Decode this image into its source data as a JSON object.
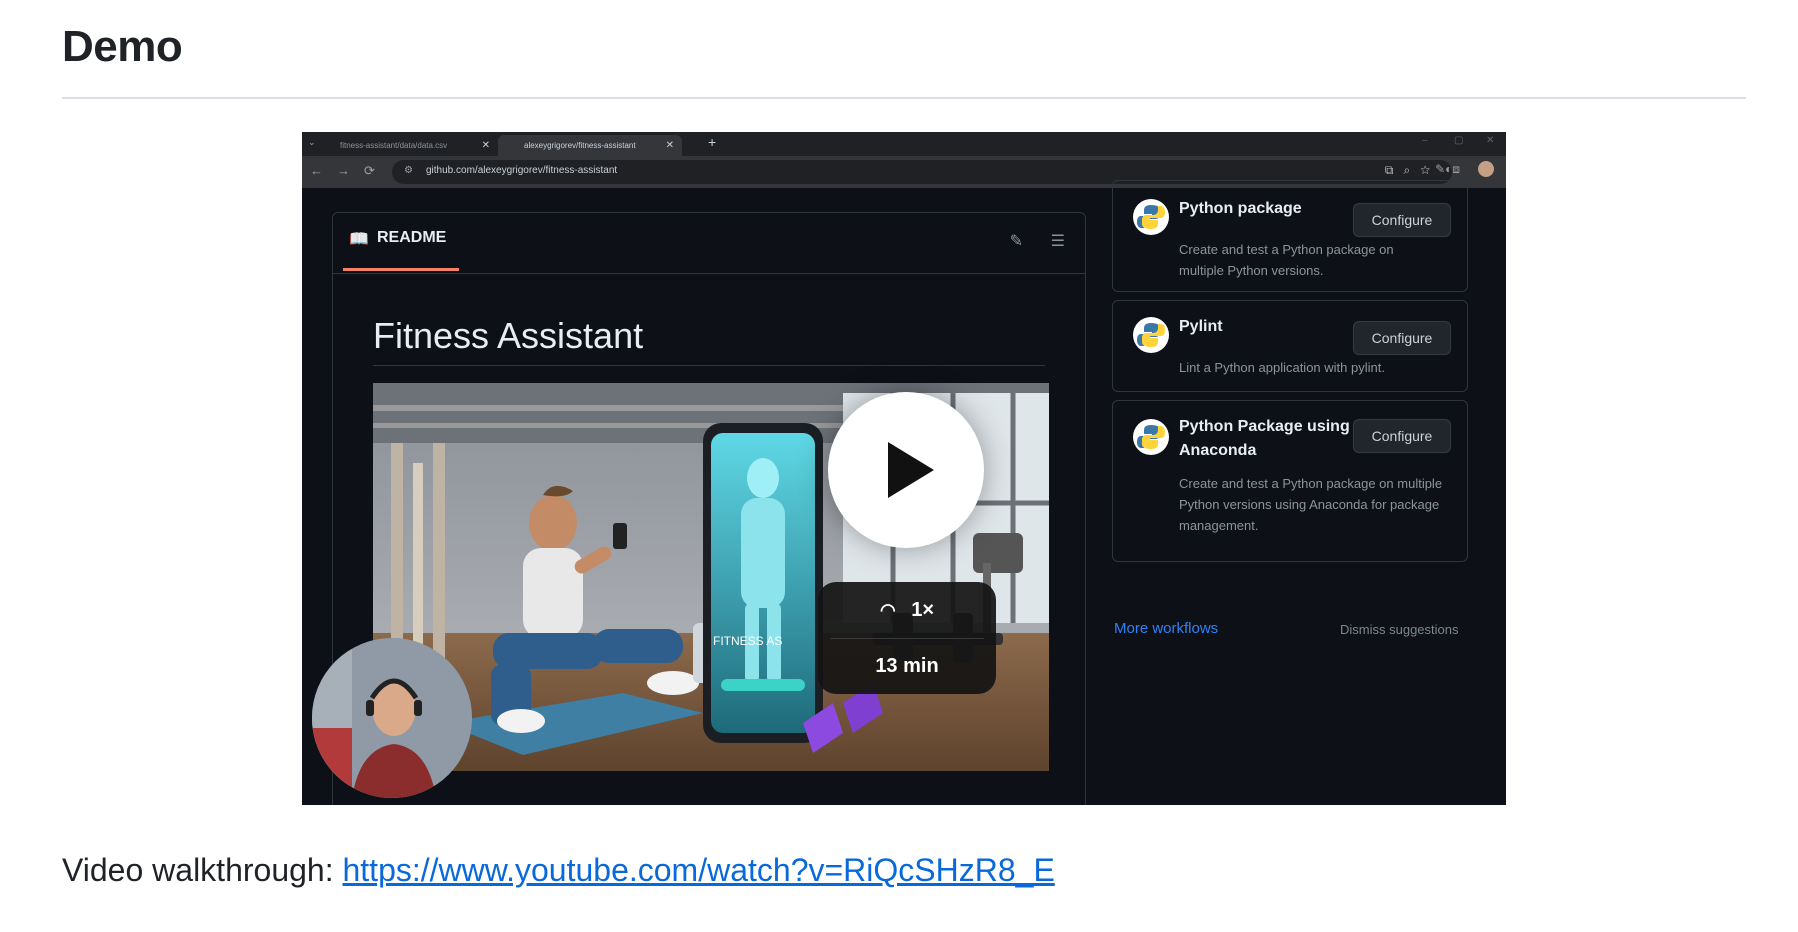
{
  "section": {
    "heading": "Demo"
  },
  "thumbnail": {
    "browser": {
      "tab1_title": "fitness-assistant/data/data.csv",
      "tab2_title": "alexeygrigorev/fitness-assistant",
      "new_tab_icon": "plus-icon",
      "url": "github.com/alexeygrigorev/fitness-assistant"
    },
    "readme": {
      "label": "README",
      "title": "Fitness Assistant",
      "phone_caption": "FITNESS AS"
    },
    "workflows": [
      {
        "title": "Python package",
        "title2": "",
        "description": "Create and test a Python package on multiple Python versions.",
        "button": "Configure"
      },
      {
        "title": "Pylint",
        "title2": "",
        "description": "Lint a Python application with pylint.",
        "button": "Configure"
      },
      {
        "title": "Python Package using",
        "title2": "Anaconda",
        "description": "Create and test a Python package on multiple Python versions using Anaconda for package management.",
        "button": "Configure"
      }
    ],
    "more_workflows": "More workflows",
    "dismiss": "Dismiss suggestions",
    "player": {
      "speed": "1×",
      "duration": "13 min"
    }
  },
  "walkthrough": {
    "label": "Video walkthrough: ",
    "link": "https://www.youtube.com/watch?v=RiQcSHzR8_E"
  },
  "colors": {
    "link": "#0969da",
    "dark_bg": "#0d1117",
    "accent_underline": "#f78166"
  }
}
